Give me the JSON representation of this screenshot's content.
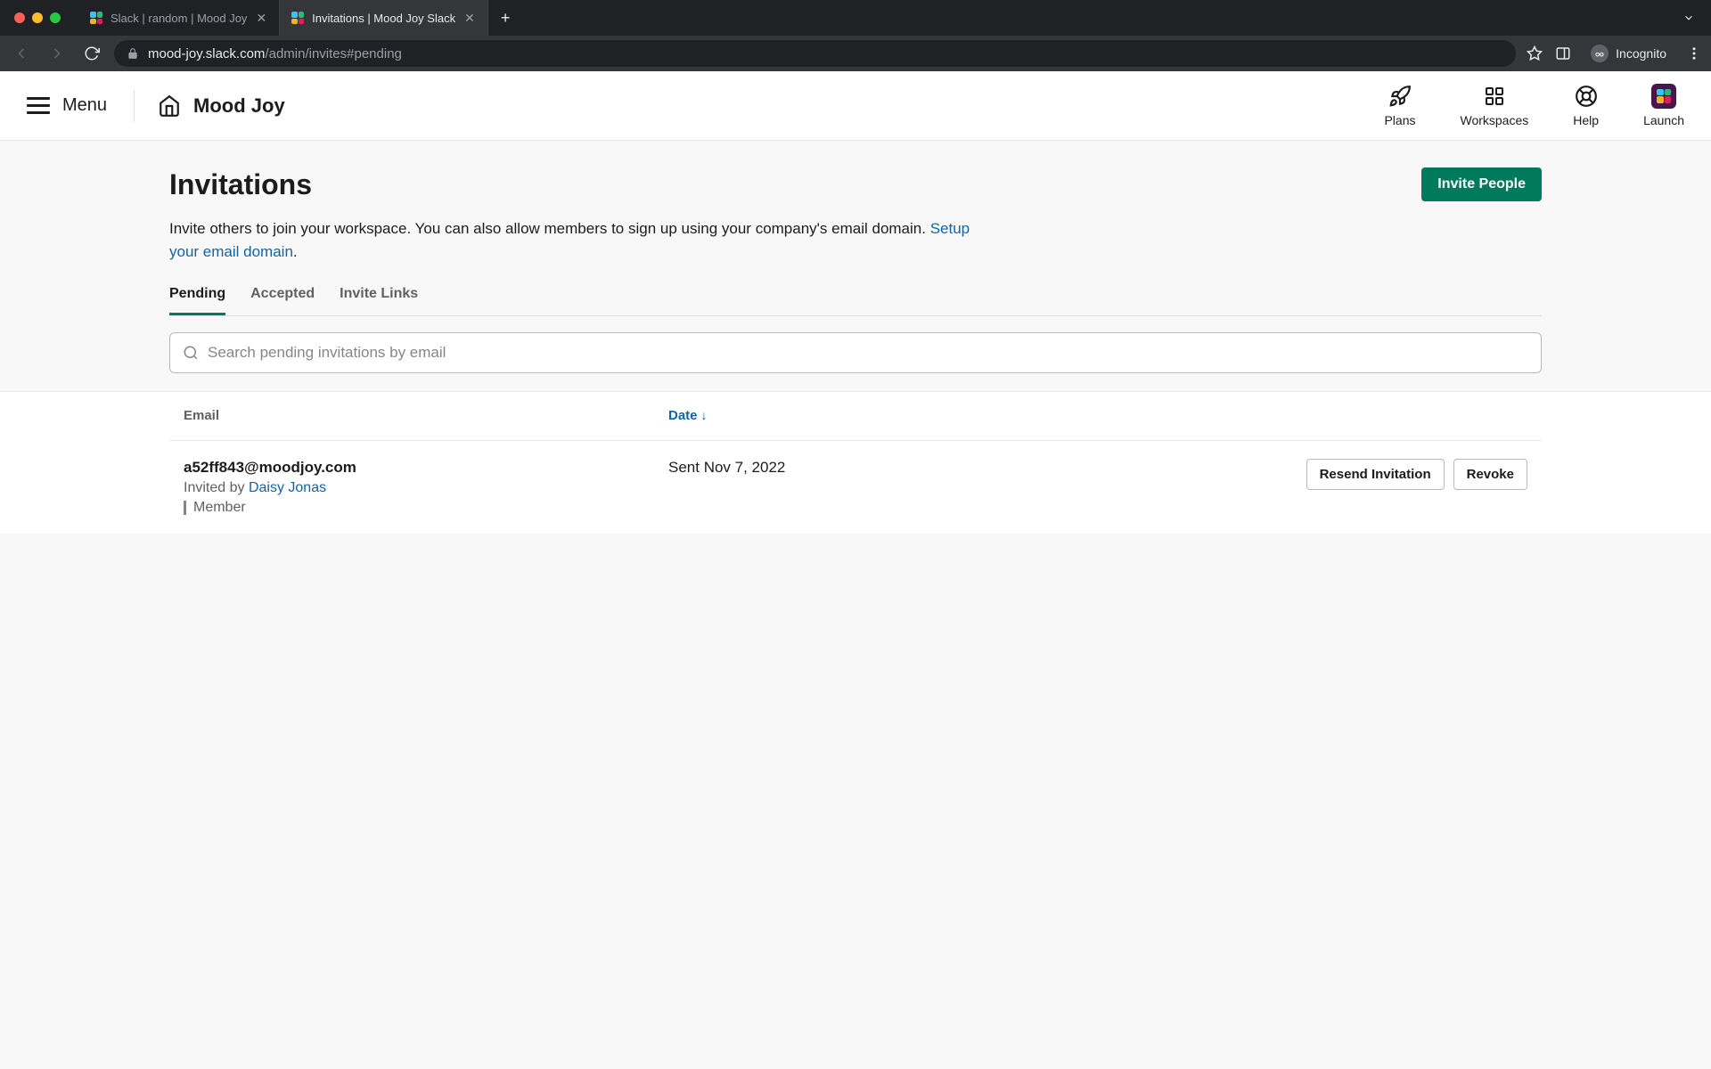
{
  "browser": {
    "tabs": [
      {
        "title": "Slack | random | Mood Joy",
        "active": false
      },
      {
        "title": "Invitations | Mood Joy Slack",
        "active": true
      }
    ],
    "url_host": "mood-joy.slack.com",
    "url_path": "/admin/invites#pending",
    "incognito_label": "Incognito"
  },
  "header": {
    "menu_label": "Menu",
    "workspace_name": "Mood Joy",
    "items": {
      "plans": "Plans",
      "workspaces": "Workspaces",
      "help": "Help",
      "launch": "Launch"
    }
  },
  "page": {
    "title": "Invitations",
    "invite_button": "Invite People",
    "description_pre": "Invite others to join your workspace. You can also allow members to sign up using your company's email domain. ",
    "description_link": "Setup your email domain",
    "description_post": "."
  },
  "tabs": {
    "pending": "Pending",
    "accepted": "Accepted",
    "invite_links": "Invite Links"
  },
  "search": {
    "placeholder": "Search pending invitations by email"
  },
  "table": {
    "headers": {
      "email": "Email",
      "date": "Date"
    },
    "rows": [
      {
        "email": "a52ff843@moodjoy.com",
        "invited_by_prefix": "Invited by ",
        "invited_by_name": "Daisy Jonas",
        "role": "Member",
        "date": "Sent Nov 7, 2022",
        "resend": "Resend Invitation",
        "revoke": "Revoke"
      }
    ]
  }
}
